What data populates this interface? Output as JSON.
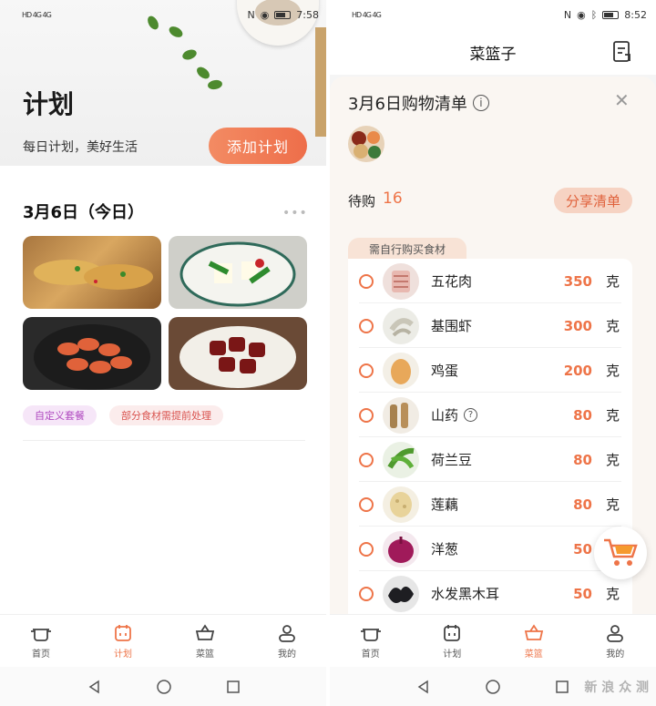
{
  "left": {
    "status": {
      "network": "HD 4G 4G",
      "time": "7:58"
    },
    "header": {
      "title": "计划",
      "subtitle": "每日计划，美好生活",
      "add_button": "添加计划"
    },
    "plan": {
      "date_title": "3月6日（今日）",
      "more_icon": "more-dots-icon"
    },
    "tags": [
      "自定义套餐",
      "部分食材需提前处理"
    ],
    "nav": [
      "首页",
      "计划",
      "菜篮",
      "我的"
    ],
    "active_nav": "计划"
  },
  "right": {
    "status": {
      "time": "8:52"
    },
    "topbar": {
      "title": "菜篮子"
    },
    "list": {
      "title": "3月6日购物清单",
      "pending_label": "待购",
      "pending_count": "16",
      "share_button": "分享清单",
      "section_label": "需自行购买食材",
      "items": [
        {
          "name": "五花肉",
          "qty": "350",
          "unit": "克"
        },
        {
          "name": "基围虾",
          "qty": "300",
          "unit": "克"
        },
        {
          "name": "鸡蛋",
          "qty": "200",
          "unit": "克"
        },
        {
          "name": "山药",
          "qty": "80",
          "unit": "克"
        },
        {
          "name": "荷兰豆",
          "qty": "80",
          "unit": "克"
        },
        {
          "name": "莲藕",
          "qty": "80",
          "unit": "克"
        },
        {
          "name": "洋葱",
          "qty": "50",
          "unit": "克"
        },
        {
          "name": "水发黑木耳",
          "qty": "50",
          "unit": "克"
        }
      ]
    },
    "nav": [
      "首页",
      "计划",
      "菜篮",
      "我的"
    ],
    "active_nav": "菜篮"
  },
  "watermark": "新 浪 众 测",
  "colors": {
    "accent": "#ee7448",
    "accent_light": "#f6d3c3",
    "tag_purple": "#b04ac0",
    "tag_red": "#d9534f"
  }
}
